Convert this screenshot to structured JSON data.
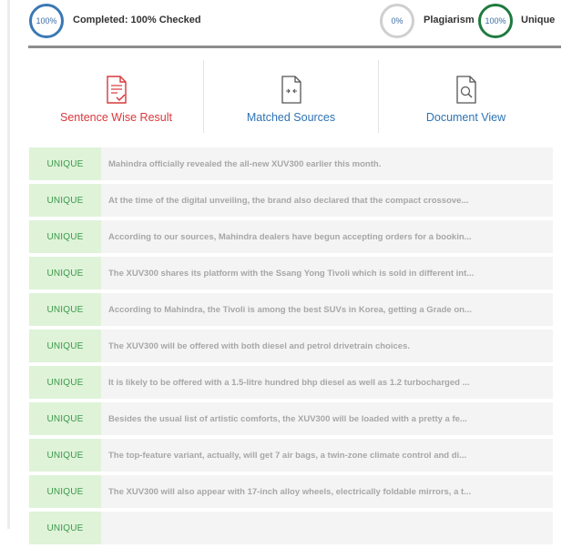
{
  "status": {
    "completed_percent": "100%",
    "completed_label": "Completed: 100% Checked",
    "plagiarism_percent": "0%",
    "plagiarism_label": "Plagiarism",
    "unique_percent": "100%",
    "unique_label": "Unique"
  },
  "tabs": [
    {
      "label": "Sentence Wise Result",
      "icon": "document-check-icon",
      "active": true
    },
    {
      "label": "Matched Sources",
      "icon": "document-compare-icon",
      "active": false
    },
    {
      "label": "Document View",
      "icon": "document-search-icon",
      "active": false
    }
  ],
  "colors": {
    "active_tab": "#d9383c",
    "inactive_tab": "#2e73b4",
    "unique_badge_bg": "#dff3d8",
    "unique_badge_text": "#3c9a4d"
  },
  "results": [
    {
      "status": "UNIQUE",
      "text": "Mahindra officially revealed the all-new XUV300 earlier this month."
    },
    {
      "status": "UNIQUE",
      "text": "At the time of the digital unveiling, the brand also declared that the compact crossove..."
    },
    {
      "status": "UNIQUE",
      "text": "According to our sources, Mahindra dealers have begun accepting orders for a bookin..."
    },
    {
      "status": "UNIQUE",
      "text": "The XUV300 shares its platform with the Ssang Yong Tivoli which is sold in different int..."
    },
    {
      "status": "UNIQUE",
      "text": "According to Mahindra, the Tivoli is among the best SUVs in Korea, getting a Grade on..."
    },
    {
      "status": "UNIQUE",
      "text": "The XUV300 will be offered with both diesel and petrol drivetrain choices."
    },
    {
      "status": "UNIQUE",
      "text": "It is likely to be offered with a 1.5-litre hundred bhp diesel as well as 1.2 turbocharged ..."
    },
    {
      "status": "UNIQUE",
      "text": "Besides the usual list of artistic comforts, the XUV300 will be loaded with a pretty a fe..."
    },
    {
      "status": "UNIQUE",
      "text": "The top-feature variant, actually, will get 7 air bags, a twin-zone climate control and di..."
    },
    {
      "status": "UNIQUE",
      "text": "The XUV300 will also appear with 17-inch alloy wheels, electrically foldable mirrors, a t..."
    },
    {
      "status": "UNIQUE",
      "text": ""
    }
  ]
}
